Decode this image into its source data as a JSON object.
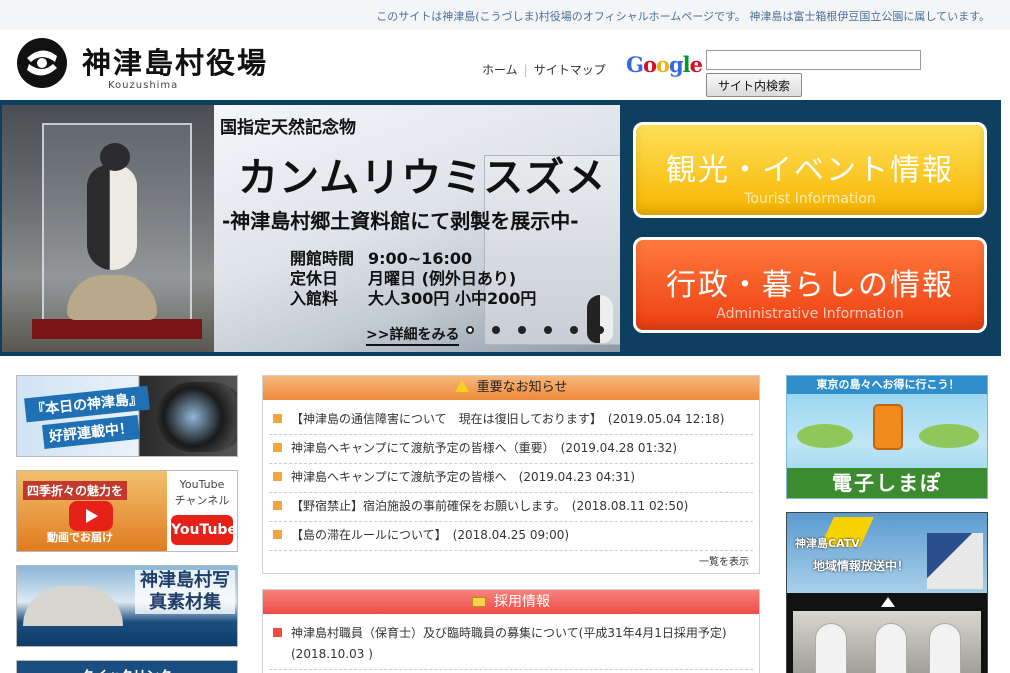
{
  "topbar": {
    "text": "このサイトは神津島(こうづしま)村役場のオフィシャルホームページです。  神津島は富士箱根伊豆国立公園に属しています。"
  },
  "header": {
    "title": "神津島村役場",
    "roman": "Kouzushima",
    "nav": [
      "ホーム",
      "サイトマップ"
    ],
    "google": {
      "letters": [
        "G",
        "o",
        "o",
        "g",
        "l",
        "e"
      ],
      "colors": [
        "#3369e8",
        "#d50f25",
        "#eeb211",
        "#3369e8",
        "#009925",
        "#d50f25"
      ]
    },
    "search_value": "",
    "search_button": "サイト内検索"
  },
  "hero": {
    "line1": "国指定天然記念物",
    "line2": "カンムリウミスズメ",
    "line3": "-神津島村郷土資料館にて剥製を展示中-",
    "info": [
      {
        "k": "開館時間",
        "v": "9:00~16:00"
      },
      {
        "k": "定休日",
        "v": "月曜日 (例外日あり)"
      },
      {
        "k": "入館料",
        "v": "大人300円 小中200円"
      }
    ],
    "more": ">>詳細をみる",
    "slides": 6,
    "active_slide": 0
  },
  "buttons": {
    "tourist": {
      "jp": "観光・イベント情報",
      "en": "Tourist Information"
    },
    "admin": {
      "jp": "行政・暮らしの情報",
      "en": "Administrative Information"
    }
  },
  "left_banners": {
    "diary": {
      "line1": "『本日の神津島』",
      "line2": "好評連載中！"
    },
    "youtube": {
      "line1": "四季折々の魅力を",
      "line2": "動画でお届け",
      "channel1": "YouTube",
      "channel2": "チャンネル",
      "logo": "YouTube"
    },
    "photos": {
      "title": "神津島村写真素材集"
    },
    "quicklink": {
      "text": "クイックリンク"
    }
  },
  "news": {
    "important": {
      "title": "重要なお知らせ",
      "items": [
        "【神津島の通信障害について　現在は復旧しております】　(2019.05.04 12:18)",
        "神津島へキャンプにて渡航予定の皆様へ（重要）　(2019.04.28 01:32)",
        "神津島へキャンプにて渡航予定の皆様へ　(2019.04.23 04:31)",
        "【野宿禁止】宿泊施設の事前確保をお願いします。　(2018.08.11 02:50)",
        "【島の滞在ルールについて】　(2018.04.25 09:00)"
      ],
      "more": "一覧を表示"
    },
    "recruit": {
      "title": "採用情報",
      "items": [
        "神津島村職員（保育士）及び臨時職員の募集について(平成31年4月1日採用予定)　(2018.10.03 )"
      ]
    }
  },
  "right_banners": {
    "ebook": {
      "top": "東京の島々へお得に行こう！",
      "label": "電子しまぽ"
    },
    "catv": {
      "line1": "神津島CATV",
      "line2": "地域情報放送中！"
    }
  }
}
